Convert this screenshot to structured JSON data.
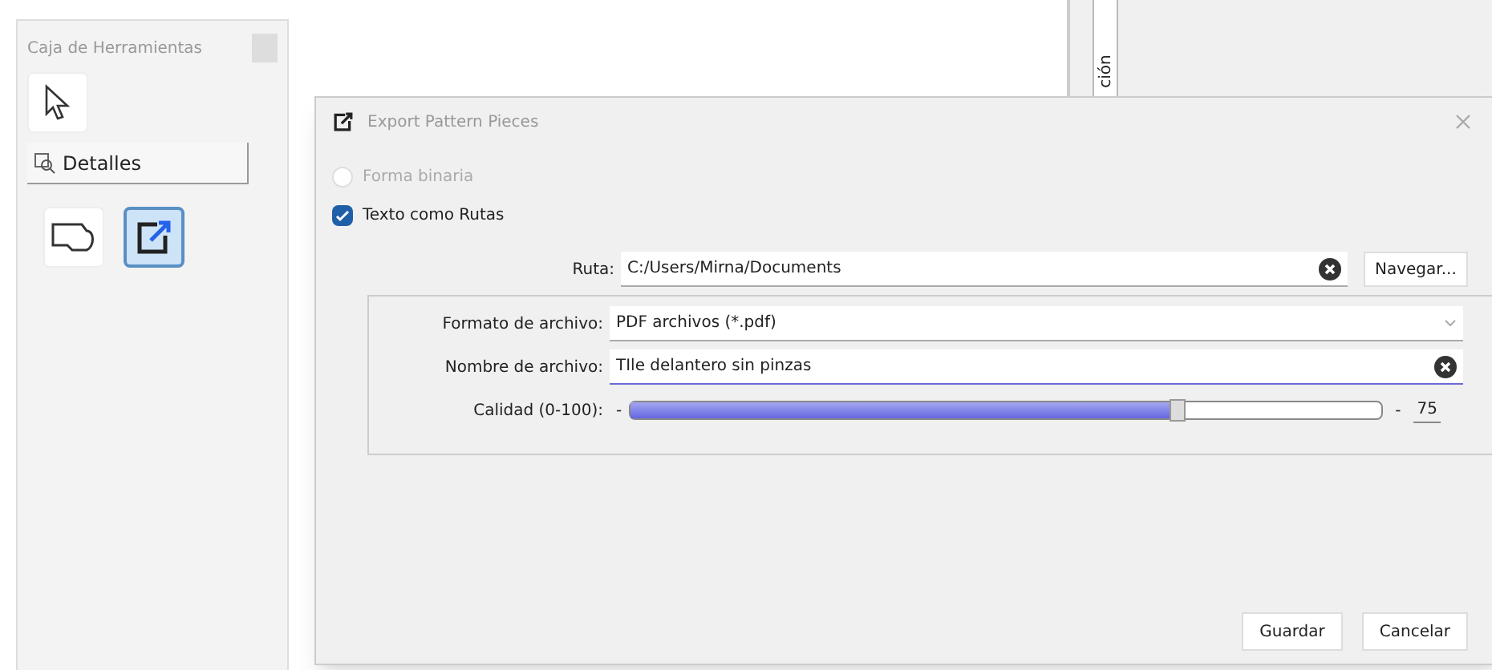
{
  "toolbox": {
    "title": "Caja de Herramientas",
    "tools": [
      {
        "kind": "pointer",
        "selected": false
      }
    ],
    "section": {
      "label": "Detalles"
    },
    "detail_tools": [
      {
        "kind": "shape",
        "selected": false
      },
      {
        "kind": "export",
        "selected": true
      }
    ]
  },
  "background_tab": {
    "label": "ción"
  },
  "dialog": {
    "title": "Export Pattern Pieces",
    "options": [
      {
        "label": "Forma binaria",
        "kind": "radio",
        "checked": false,
        "disabled": true
      },
      {
        "label": "Texto como Rutas",
        "kind": "checkbox",
        "checked": true,
        "disabled": false
      }
    ],
    "path": {
      "label": "Ruta:",
      "value": "C:/Users/Mirna/Documents",
      "button": "Navegar..."
    },
    "format": {
      "label": "Formato de archivo:",
      "value": "PDF archivos (*.pdf)"
    },
    "filename": {
      "label": "Nombre de archivo:",
      "value": "TIle delantero sin pinzas"
    },
    "quality": {
      "label": "Calidad (0-100):",
      "minus": "-",
      "level": 0.73,
      "plus": "-",
      "reading": "75"
    },
    "buttons": [
      "Guardar",
      "Cancelar"
    ]
  }
}
